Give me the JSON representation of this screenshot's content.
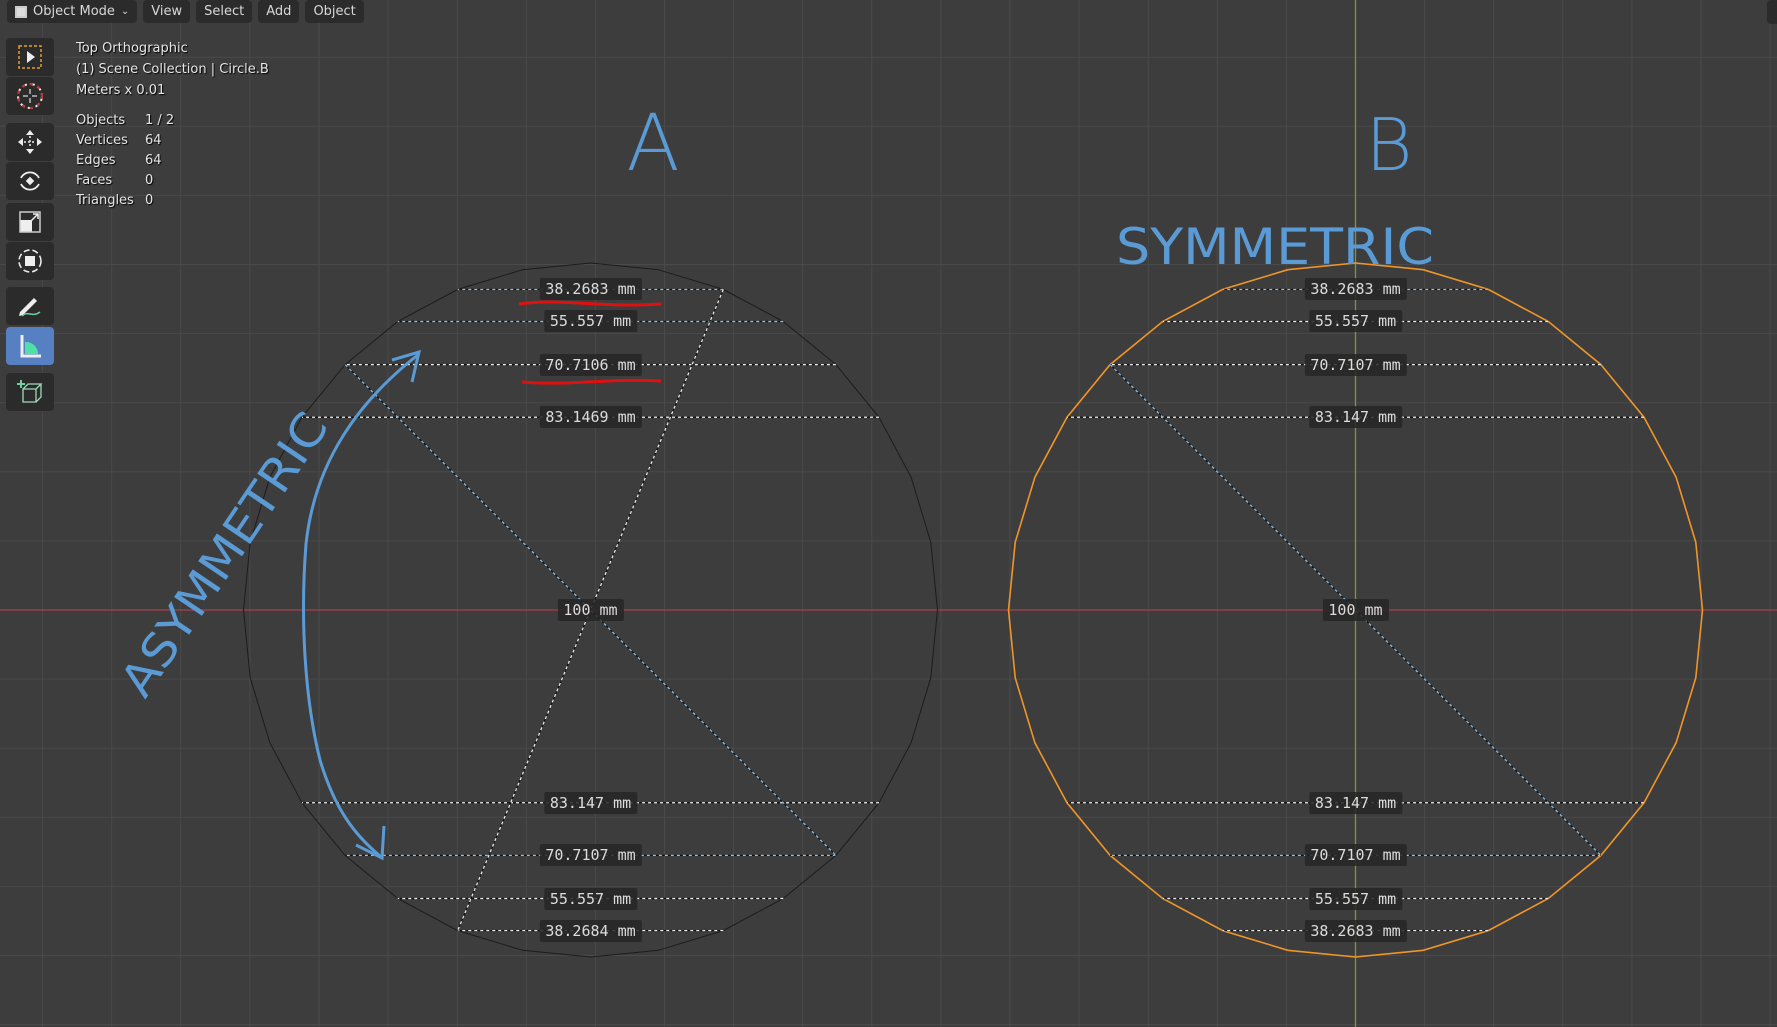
{
  "header": {
    "mode_label": "Object Mode",
    "menus": [
      "View",
      "Select",
      "Add",
      "Object"
    ]
  },
  "overlay": {
    "view_name": "Top Orthographic",
    "collection": "(1) Scene Collection | Circle.B",
    "units": "Meters x 0.01",
    "stats": [
      {
        "label": "Objects",
        "value": "1 / 2"
      },
      {
        "label": "Vertices",
        "value": "64"
      },
      {
        "label": "Edges",
        "value": "64"
      },
      {
        "label": "Faces",
        "value": "0"
      },
      {
        "label": "Triangles",
        "value": "0"
      }
    ]
  },
  "toolbar": {
    "tools": [
      "select-box",
      "cursor",
      "move",
      "rotate",
      "scale",
      "transform",
      "annotate",
      "measure",
      "add-cube"
    ],
    "active_tool": "measure"
  },
  "colors": {
    "background": "#3d3d3d",
    "x_axis": "#a8414a",
    "y_axis": "#7f9a2a",
    "selected_object": "#f0952a",
    "unselected_object": "#1c1c1c",
    "handwriting": "#5b9bd5",
    "underline": "#e01010",
    "active_tool": "#5680c2"
  },
  "circles": {
    "A": {
      "top_measurements": [
        "38.2683 mm",
        "55.557 mm",
        "70.7106 mm",
        "83.1469 mm"
      ],
      "bottom_measurements": [
        "83.147 mm",
        "70.7107 mm",
        "55.557 mm",
        "38.2684 mm"
      ],
      "diameter": "100 mm"
    },
    "B": {
      "top_measurements": [
        "38.2683 mm",
        "55.557 mm",
        "70.7107 mm",
        "83.147 mm"
      ],
      "bottom_measurements": [
        "83.147 mm",
        "70.7107 mm",
        "55.557 mm",
        "38.2683 mm"
      ],
      "diameter": "100 mm"
    }
  },
  "annotations": {
    "label_a": "A",
    "label_b": "B",
    "symmetric": "SYMMETRIC",
    "asymmetric": "ASYMMETRIC"
  }
}
